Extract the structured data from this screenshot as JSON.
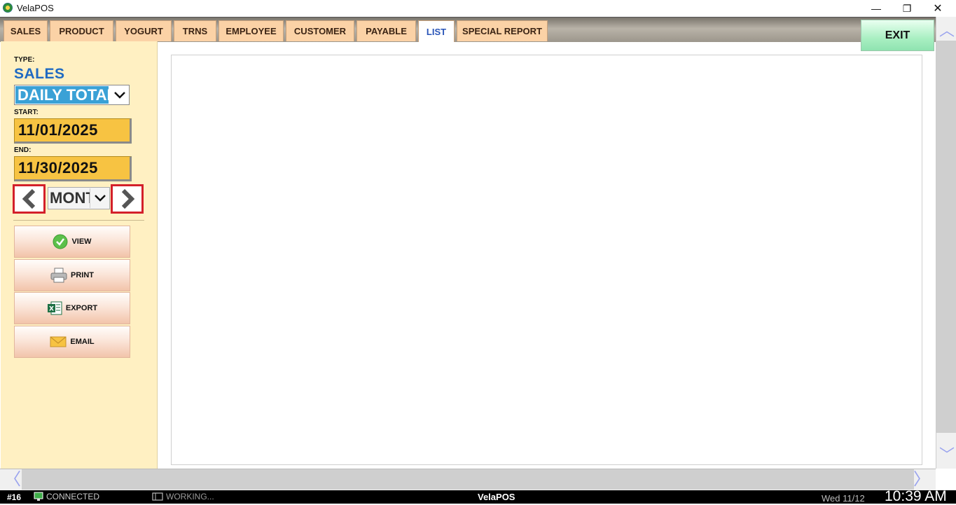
{
  "window": {
    "title": "VelaPOS",
    "minimize_glyph": "—",
    "maximize_glyph": "❐",
    "close_glyph": "✕"
  },
  "tabs": [
    {
      "label": "SALES",
      "active": false
    },
    {
      "label": "PRODUCT",
      "active": false
    },
    {
      "label": "YOGURT",
      "active": false
    },
    {
      "label": "TRNS",
      "active": false
    },
    {
      "label": "EMPLOYEE",
      "active": false
    },
    {
      "label": "CUSTOMER",
      "active": false
    },
    {
      "label": "PAYABLE",
      "active": false
    },
    {
      "label": "LIST",
      "active": true
    },
    {
      "label": "SPECIAL REPORT",
      "active": false
    }
  ],
  "exit_label": "EXIT",
  "report": {
    "type_label": "TYPE:",
    "type_value": "SALES",
    "report_select_value": "DAILY TOTAL",
    "start_label": "START:",
    "start_date": "11/01/2025",
    "end_label": "END:",
    "end_date": "11/30/2025",
    "period_select_value": "MONTH",
    "buttons": {
      "view": "VIEW",
      "print": "PRINT",
      "export": "EXPORT",
      "email": "EMAIL"
    }
  },
  "status": {
    "terminal": "#16",
    "connection": "CONNECTED",
    "working": "WORKING...",
    "app_name": "VelaPOS",
    "date": "Wed 11/12",
    "time": "10:39 AM"
  },
  "icons": {
    "prev": "chevron-left-icon",
    "next": "chevron-right-icon",
    "view": "check-circle-icon",
    "print": "printer-icon",
    "export": "excel-icon",
    "email": "envelope-icon"
  },
  "colors": {
    "panel_bg": "#fff0c2",
    "tab_bg": "#fbd2a6",
    "active_tab_text": "#2a55b8",
    "type_text": "#1f6ac2",
    "date_bg": "#f7c342",
    "highlight_border": "#d3202a",
    "exit_bg": "#a9efc2"
  }
}
